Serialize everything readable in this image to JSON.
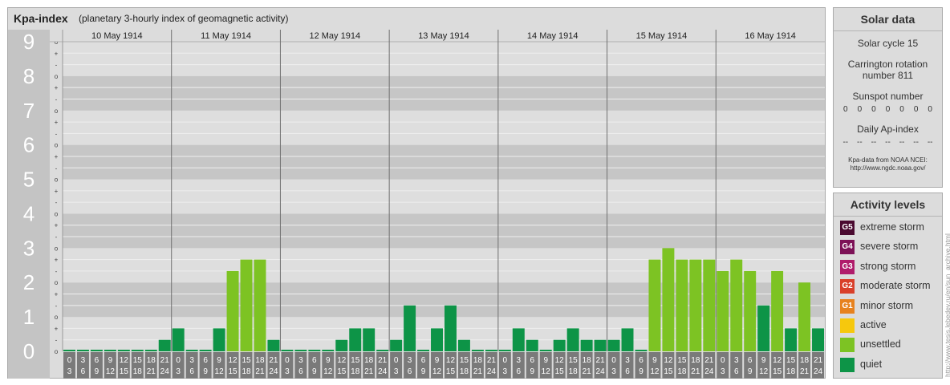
{
  "title": {
    "main": "Kpa-index",
    "sub": "(planetary 3-hourly index of geomagnetic activity)"
  },
  "y_labels": [
    "0",
    "1",
    "2",
    "3",
    "4",
    "5",
    "6",
    "7",
    "8",
    "9"
  ],
  "y_minor_labels": [
    "o",
    "-",
    "+"
  ],
  "time_labels": {
    "start": [
      "0",
      "3",
      "6",
      "9",
      "12",
      "15",
      "18",
      "21"
    ],
    "end": [
      "3",
      "6",
      "9",
      "12",
      "15",
      "18",
      "21",
      "24"
    ]
  },
  "chart_data": {
    "type": "bar",
    "title": "Kpa-index",
    "subtitle": "(planetary 3-hourly index of geomagnetic activity)",
    "ylim": [
      0,
      9
    ],
    "categories": [
      "10 May 1914",
      "11 May 1914",
      "12 May 1914",
      "13 May 1914",
      "14 May 1914",
      "15 May 1914",
      "16 May 1914"
    ],
    "interval_hours": 3,
    "values": [
      [
        0,
        0,
        0,
        0,
        0,
        0,
        0,
        0.333
      ],
      [
        0.667,
        0,
        0,
        0.667,
        2.333,
        2.667,
        2.667,
        0.333
      ],
      [
        0,
        0,
        0,
        0,
        0.333,
        0.667,
        0.667,
        0
      ],
      [
        0.333,
        1.333,
        0,
        0.667,
        1.333,
        0.333,
        0,
        0
      ],
      [
        0,
        0.667,
        0.333,
        0,
        0.333,
        0.667,
        0.333,
        0.333
      ],
      [
        0.333,
        0.667,
        0,
        2.667,
        3,
        2.667,
        2.667,
        2.667
      ],
      [
        2.333,
        2.667,
        2.333,
        1.333,
        2.333,
        0.667,
        2,
        0.667
      ]
    ],
    "level_colors": {
      "quiet": "#0d9447",
      "unsettled": "#7dc323"
    }
  },
  "solar": {
    "title": "Solar data",
    "cycle": "Solar cycle 15",
    "carrington_1": "Carrington rotation",
    "carrington_2": "number 811",
    "sunspot_label": "Sunspot number",
    "sunspot_values": [
      "0",
      "0",
      "0",
      "0",
      "0",
      "0",
      "0"
    ],
    "ap_label": "Daily Ap-index",
    "ap_values": [
      "--",
      "--",
      "--",
      "--",
      "--",
      "--",
      "--"
    ],
    "credit_1": "Kpa-data from NOAA NCEI:",
    "credit_2": "http://www.ngdc.noaa.gov/"
  },
  "activity": {
    "title": "Activity levels",
    "levels": [
      {
        "code": "G5",
        "label": "extreme storm",
        "color": "#4b0a30"
      },
      {
        "code": "G4",
        "label": "severe storm",
        "color": "#7d1257"
      },
      {
        "code": "G3",
        "label": "strong storm",
        "color": "#b01c6b"
      },
      {
        "code": "G2",
        "label": "moderate storm",
        "color": "#d9402a"
      },
      {
        "code": "G1",
        "label": "minor storm",
        "color": "#e7821e"
      },
      {
        "code": "",
        "label": "active",
        "color": "#f6c80d"
      },
      {
        "code": "",
        "label": "unsettled",
        "color": "#7dc323"
      },
      {
        "code": "",
        "label": "quiet",
        "color": "#0d9447"
      }
    ]
  },
  "watermark": "http://www.tesis.lebedev.ru/en/sun_archive.html"
}
